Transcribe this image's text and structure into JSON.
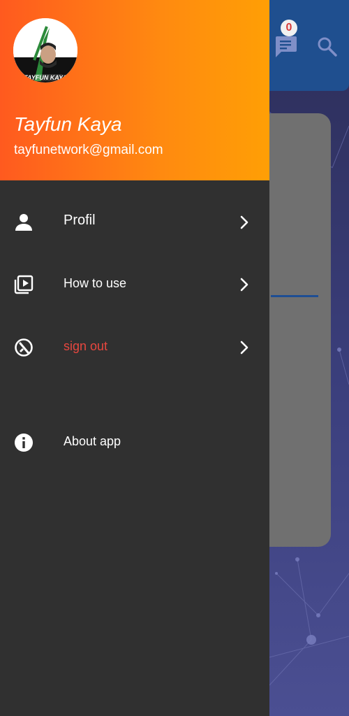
{
  "app_bar": {
    "notification_count": "0",
    "icons": {
      "chat": "chat-icon",
      "search": "search-icon"
    },
    "colors": {
      "bar": "#1f4f8f",
      "badge_text": "#d63b3b"
    }
  },
  "drawer": {
    "header": {
      "name": "Tayfun Kaya",
      "email": "tayfunetwork@gmail.com",
      "avatar": "avatar-image",
      "gradient_start": "#ff5a1f",
      "gradient_end": "#ff9f05"
    },
    "items": [
      {
        "label": "Profil",
        "icon": "person-icon",
        "has_chevron": true
      },
      {
        "label": "How to use",
        "icon": "video-library-icon",
        "has_chevron": true
      },
      {
        "label": "sign out",
        "icon": "sign-out-icon",
        "has_chevron": true,
        "color": "#e8473f"
      },
      {
        "label": "About app",
        "icon": "info-icon",
        "has_chevron": false
      }
    ],
    "background": "#303030"
  }
}
